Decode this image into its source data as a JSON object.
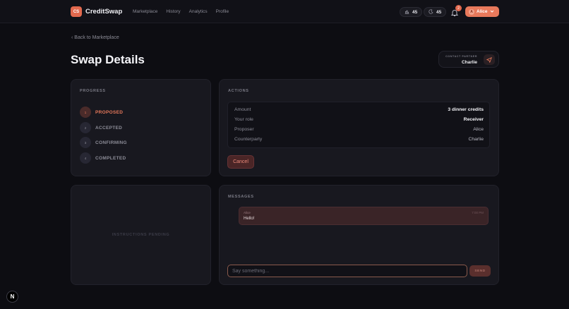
{
  "app": {
    "logo_badge": "CS",
    "name": "CreditSwap",
    "nav": [
      "Marketplace",
      "History",
      "Analytics",
      "Profile"
    ],
    "stats": [
      {
        "icon": "medal-icon",
        "value": "45"
      },
      {
        "icon": "moon-icon",
        "value": "45"
      }
    ],
    "notification_count": "2",
    "user": {
      "initial": "A",
      "name": "Alice"
    }
  },
  "page": {
    "back_label": "Back to Marketplace",
    "title": "Swap Details",
    "contact": {
      "label": "CONTACT PARTNER",
      "name": "Charlie"
    }
  },
  "progress": {
    "heading": "PROGRESS",
    "steps": [
      {
        "num": "1",
        "label": "PROPOSED",
        "active": true
      },
      {
        "num": "2",
        "label": "ACCEPTED",
        "active": false
      },
      {
        "num": "3",
        "label": "CONFIRMING",
        "active": false
      },
      {
        "num": "4",
        "label": "COMPLETED",
        "active": false
      }
    ]
  },
  "actions": {
    "heading": "ACTIONS",
    "details": [
      {
        "key": "Amount",
        "value": "3 dinner credits"
      },
      {
        "key": "Your role",
        "value": "Receiver"
      },
      {
        "key": "Proposer",
        "value": "Alice"
      },
      {
        "key": "Counterparty",
        "value": "Charlie"
      }
    ],
    "cancel_label": "Cancel"
  },
  "instructions": {
    "pending_label": "INSTRUCTIONS PENDING"
  },
  "messages": {
    "heading": "MESSAGES",
    "items": [
      {
        "sender": "Alice",
        "time": "7:00 PM",
        "text": "Hello!"
      }
    ],
    "input_placeholder": "Say something...",
    "send_label": "SEND"
  },
  "dev_badge": "N",
  "colors": {
    "accent": "#e8795b",
    "background": "#0d0d12",
    "card": "#18181f"
  }
}
